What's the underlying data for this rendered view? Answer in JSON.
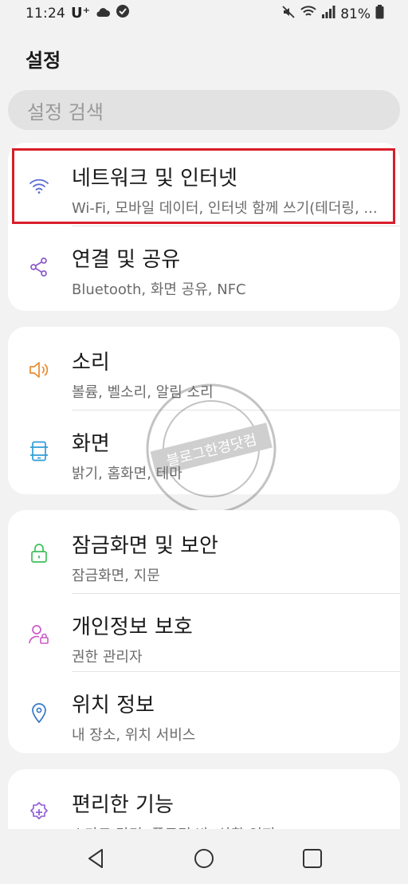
{
  "status_bar": {
    "time": "11:24",
    "carrier": "U⁺",
    "battery_text": "81%"
  },
  "header": {
    "title": "설정"
  },
  "search": {
    "placeholder": "설정 검색"
  },
  "groups": [
    {
      "items": [
        {
          "title": "네트워크 및 인터넷",
          "subtitle": "Wi-Fi, 모바일 데이터, 인터넷 함께 쓰기(테더링, ...",
          "icon": "wifi-icon",
          "highlighted": true
        },
        {
          "title": "연결 및 공유",
          "subtitle": "Bluetooth, 화면 공유, NFC",
          "icon": "share-icon"
        }
      ]
    },
    {
      "items": [
        {
          "title": "소리",
          "subtitle": "볼륨, 벨소리, 알림 소리",
          "icon": "speaker-icon"
        },
        {
          "title": "화면",
          "subtitle": "밝기, 홈화면, 테마",
          "icon": "display-icon"
        }
      ]
    },
    {
      "items": [
        {
          "title": "잠금화면 및 보안",
          "subtitle": "잠금화면, 지문",
          "icon": "lock-icon"
        },
        {
          "title": "개인정보 보호",
          "subtitle": "권한 관리자",
          "icon": "privacy-person-icon"
        },
        {
          "title": "위치 정보",
          "subtitle": "내 장소, 위치 서비스",
          "icon": "location-pin-icon"
        }
      ]
    },
    {
      "items": [
        {
          "title": "편리한 기능",
          "subtitle": "스마트 닥터, 플로팅 바, 상황 인지",
          "icon": "gear-plus-icon"
        }
      ]
    }
  ],
  "watermark": {
    "text": "블로그한경닷컴"
  },
  "colors": {
    "highlight_border": "#d81e2a",
    "wifi": "#5b6bd6",
    "share": "#8c5bc9",
    "speaker": "#e98a2f",
    "display": "#2f9ed8",
    "lock": "#3fbf5a",
    "privacy": "#c85cc8",
    "location": "#3577c9",
    "gear": "#8e5bd6"
  }
}
